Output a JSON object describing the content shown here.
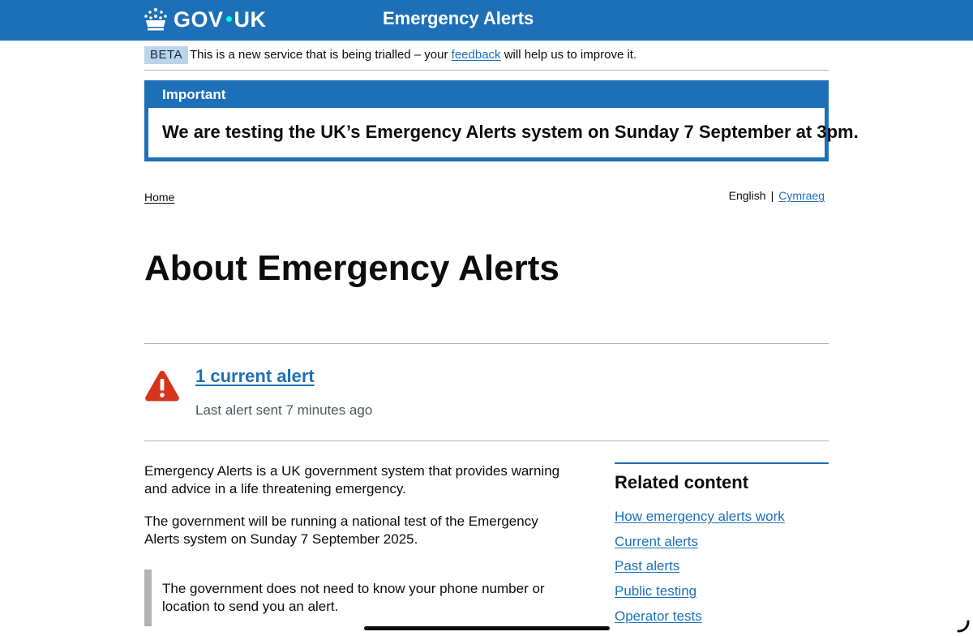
{
  "header": {
    "logo_text_left": "GOV",
    "logo_text_right": "UK",
    "crown_icon": "crown-icon",
    "service_name": "Emergency Alerts",
    "colors": {
      "brand_blue": "#1d70b8",
      "dot": "#00ffe0"
    }
  },
  "phase_banner": {
    "tag": "BETA",
    "text_before": "This is a new service that is being trialled – your",
    "link": "feedback",
    "text_after": "will help us to improve it."
  },
  "notification": {
    "title": "Important",
    "body": "We are testing the UK’s Emergency Alerts system on Sunday 7 September at 3pm."
  },
  "breadcrumb": {
    "home": "Home"
  },
  "language": {
    "current": "English",
    "separator": "|",
    "other": "Cymraeg"
  },
  "page_title": "About Emergency Alerts",
  "alerts_summary": {
    "icon": "warning-triangle-icon",
    "link": "1 current alert",
    "last_sent": "Last alert sent 7 minutes ago",
    "colors": {
      "warning_red": "#d4351c"
    }
  },
  "main": {
    "paragraphs": [
      "Emergency Alerts is a UK government system that provides warning and advice in a life threatening emergency.",
      "The government will be running a national test of the Emergency Alerts system on Sunday 7 September 2025."
    ],
    "inset": "The government does not need to know your phone number or location to send you an alert."
  },
  "related": {
    "title": "Related content",
    "links": [
      "How emergency alerts work",
      "Current alerts",
      "Past alerts",
      "Public testing",
      "Operator tests"
    ]
  }
}
